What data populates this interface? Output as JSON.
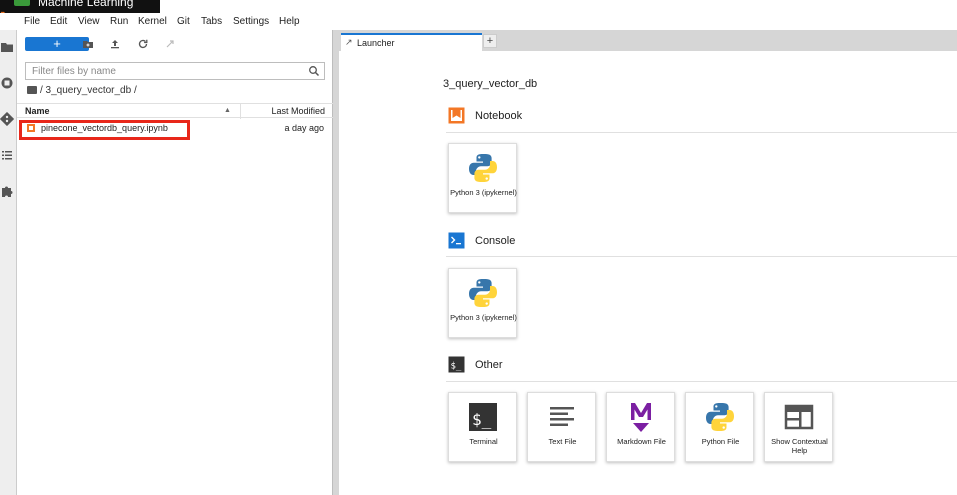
{
  "app": {
    "title": "Machine Learning"
  },
  "menubar": {
    "items": [
      "File",
      "Edit",
      "View",
      "Run",
      "Kernel",
      "Git",
      "Tabs",
      "Settings",
      "Help"
    ]
  },
  "filebrowser": {
    "new_label": "+",
    "filter_placeholder": "Filter files by name",
    "breadcrumb": "/ 3_query_vector_db /",
    "columns": {
      "name": "Name",
      "modified": "Last Modified"
    },
    "files": [
      {
        "name": "pinecone_vectordb_query.ipynb",
        "modified": "a day ago",
        "highlighted": true
      }
    ]
  },
  "tabs": [
    {
      "label": "Launcher",
      "active": true
    }
  ],
  "add_tab_label": "+",
  "launcher": {
    "cwd": "3_query_vector_db",
    "sections": [
      {
        "title": "Notebook",
        "icon": "notebook-icon",
        "cards": [
          {
            "label": "Python 3 (ipykernel)",
            "icon": "python-icon"
          }
        ]
      },
      {
        "title": "Console",
        "icon": "console-icon",
        "cards": [
          {
            "label": "Python 3 (ipykernel)",
            "icon": "python-icon"
          }
        ]
      },
      {
        "title": "Other",
        "icon": "terminal-icon",
        "cards": [
          {
            "label": "Terminal",
            "icon": "terminal-icon"
          },
          {
            "label": "Text File",
            "icon": "text-file-icon"
          },
          {
            "label": "Markdown File",
            "icon": "markdown-icon"
          },
          {
            "label": "Python File",
            "icon": "python-icon"
          },
          {
            "label": "Show Contextual Help",
            "icon": "contextual-help-icon"
          }
        ]
      }
    ]
  },
  "colors": {
    "accent": "#1976d2",
    "highlight": "#e8271a",
    "notebook_orange": "#f37726",
    "markdown_purple": "#7b1fa2",
    "python_blue": "#3776ab",
    "python_yellow": "#ffd43b"
  }
}
